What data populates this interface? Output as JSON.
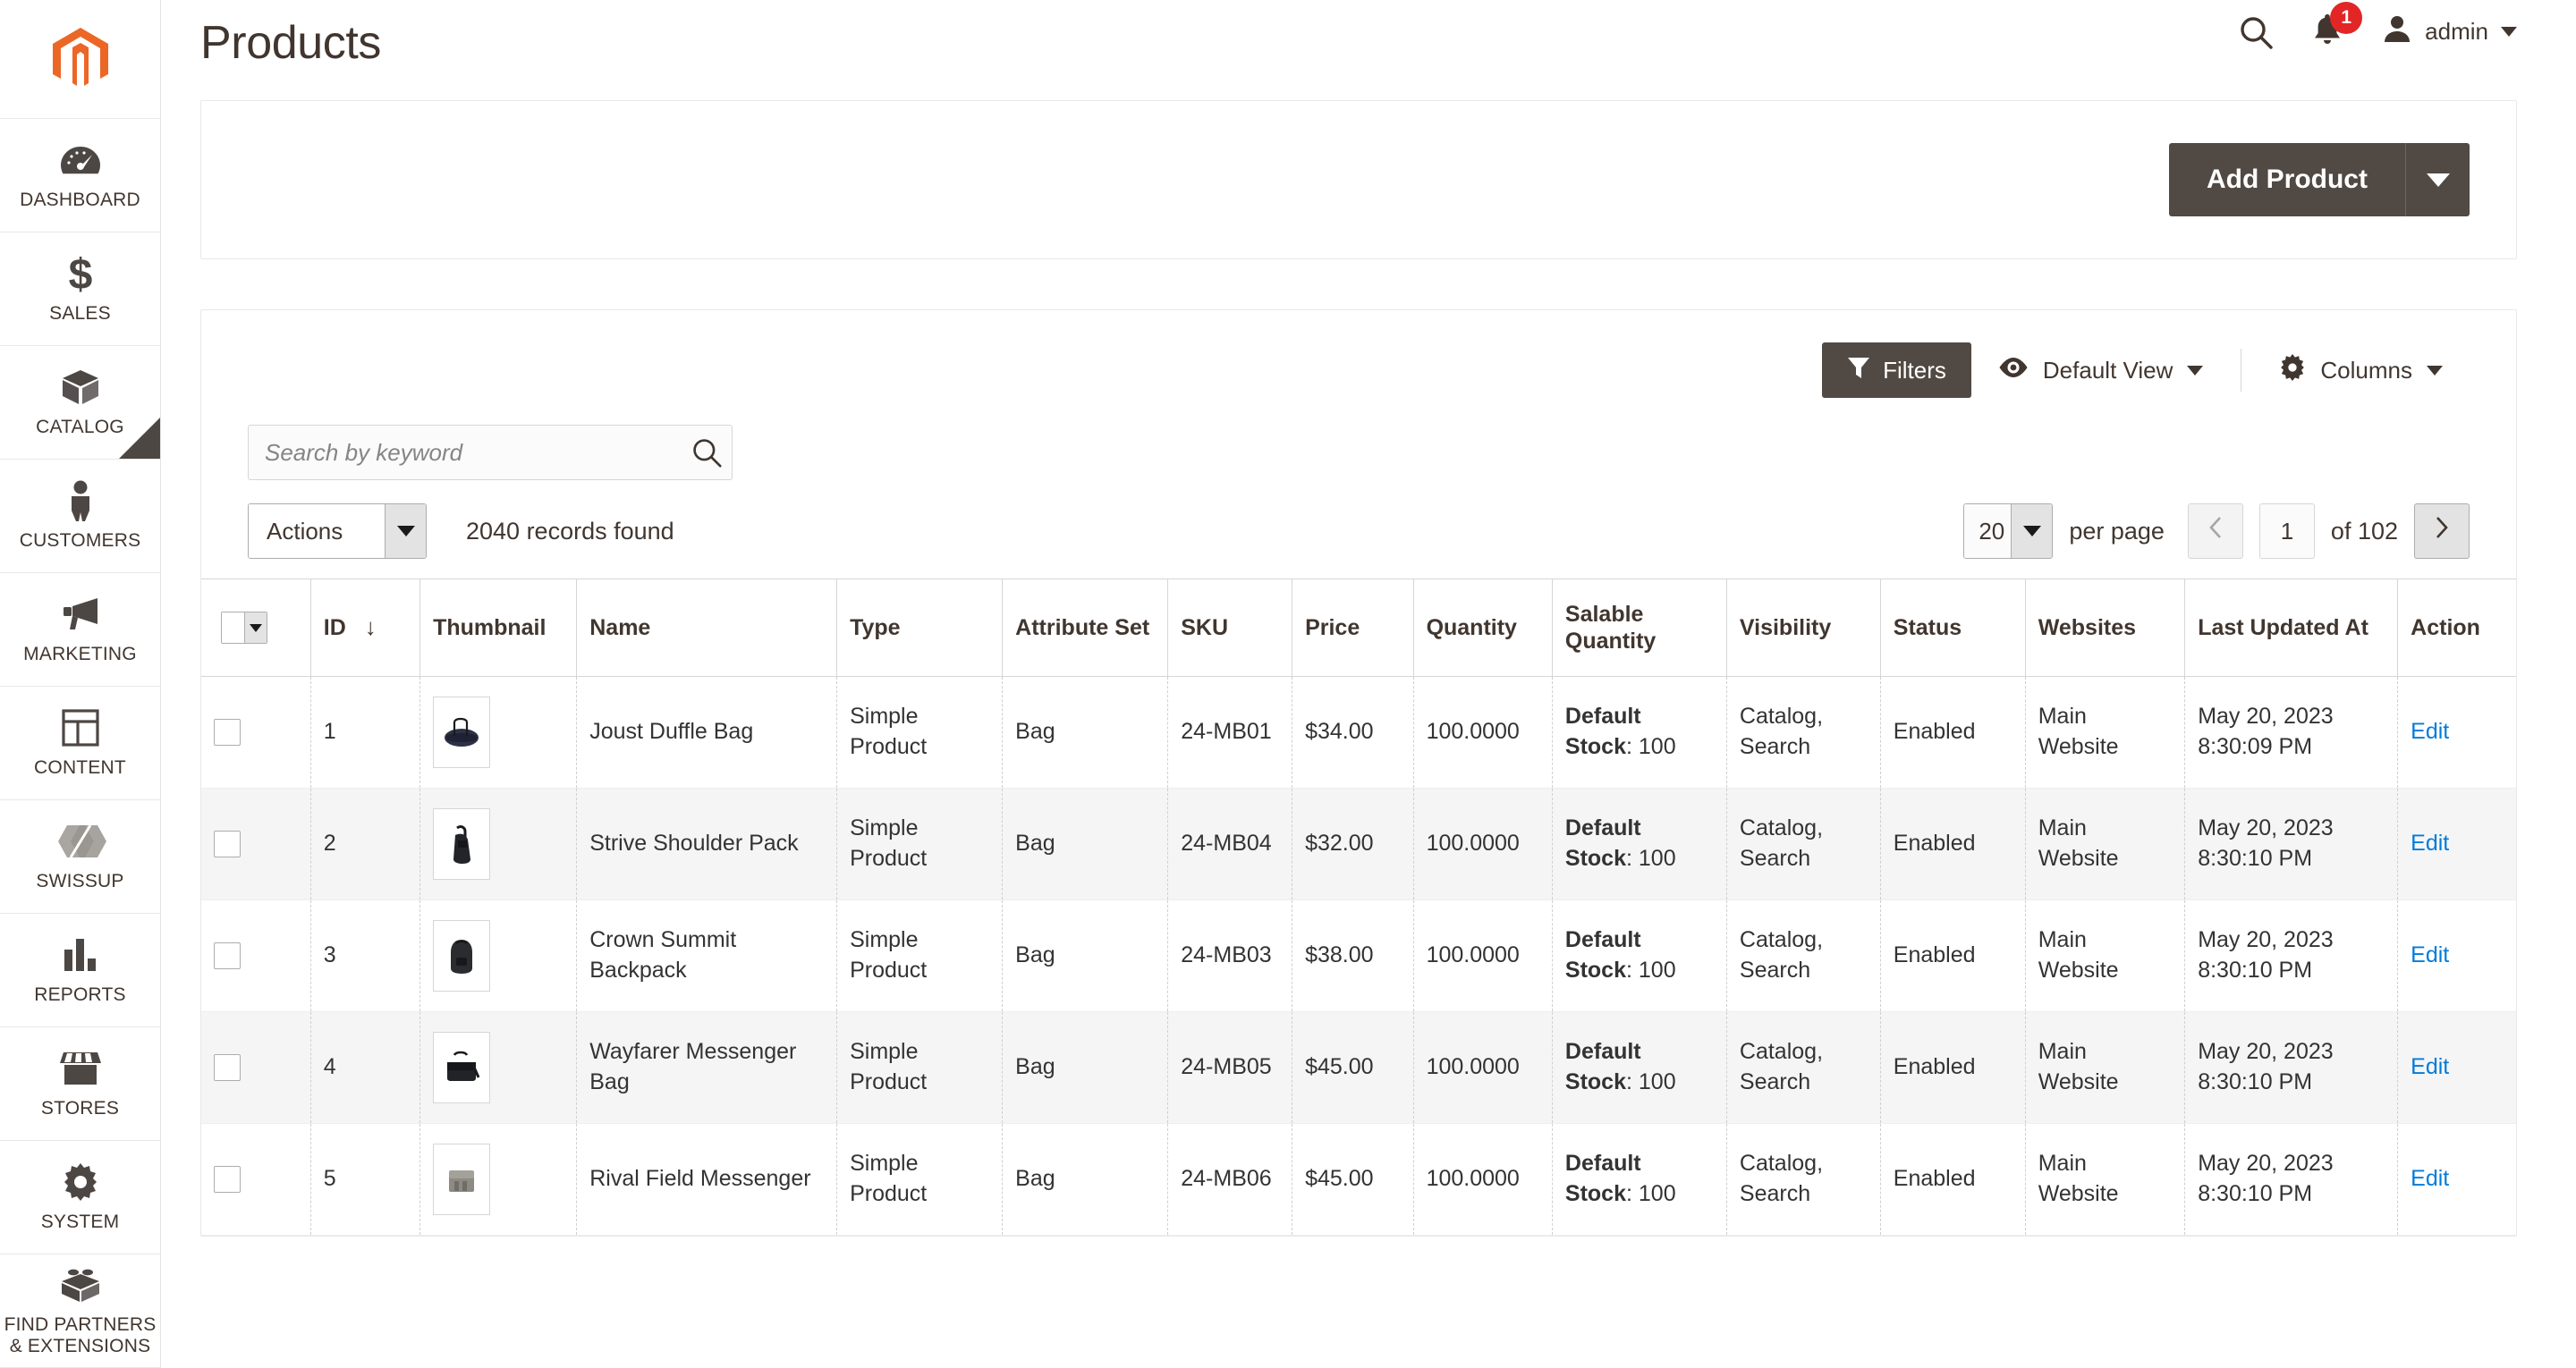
{
  "sidebar": {
    "logo_name": "magento-logo",
    "items": [
      {
        "label": "DASHBOARD",
        "icon": "dashboard-icon",
        "active": false
      },
      {
        "label": "SALES",
        "icon": "dollar-icon",
        "active": false
      },
      {
        "label": "CATALOG",
        "icon": "box-icon",
        "active": true
      },
      {
        "label": "CUSTOMERS",
        "icon": "person-icon",
        "active": false
      },
      {
        "label": "MARKETING",
        "icon": "megaphone-icon",
        "active": false
      },
      {
        "label": "CONTENT",
        "icon": "layout-icon",
        "active": false
      },
      {
        "label": "SWISSUP",
        "icon": "swissup-icon",
        "active": false
      },
      {
        "label": "REPORTS",
        "icon": "bar-chart-icon",
        "active": false
      },
      {
        "label": "STORES",
        "icon": "storefront-icon",
        "active": false
      },
      {
        "label": "SYSTEM",
        "icon": "gear-icon",
        "active": false
      },
      {
        "label": "FIND PARTNERS & EXTENSIONS",
        "icon": "brick-icon",
        "active": false
      }
    ]
  },
  "header": {
    "title": "Products",
    "search_icon": "search-icon",
    "notifications_icon": "bell-icon",
    "notifications_count": "1",
    "user_icon": "user-avatar-icon",
    "user_name": "admin"
  },
  "page_actions": {
    "add_product_label": "Add Product",
    "add_product_toggle_icon": "chevron-down-icon"
  },
  "grid_toolbar": {
    "filters_label": "Filters",
    "filters_icon": "funnel-icon",
    "view_icon": "eye-icon",
    "view_label": "Default View",
    "columns_icon": "gear-icon",
    "columns_label": "Columns"
  },
  "search": {
    "placeholder": "Search by keyword",
    "value": "",
    "button_icon": "search-icon"
  },
  "controls": {
    "actions_label": "Actions",
    "records_found": "2040 records found",
    "per_page_value": "20",
    "per_page_label": "per page",
    "prev_icon": "chevron-left-icon",
    "next_icon": "chevron-right-icon",
    "page_value": "1",
    "of_label": "of 102"
  },
  "table": {
    "columns": [
      "ID",
      "Thumbnail",
      "Name",
      "Type",
      "Attribute Set",
      "SKU",
      "Price",
      "Quantity",
      "Salable Quantity",
      "Visibility",
      "Status",
      "Websites",
      "Last Updated At",
      "Action"
    ],
    "sort_column": "ID",
    "sort_direction": "↓",
    "rows": [
      {
        "id": "1",
        "thumb": "duffle-bag-thumbnail",
        "name": "Joust Duffle Bag",
        "type": "Simple Product",
        "attribute_set": "Bag",
        "sku": "24-MB01",
        "price": "$34.00",
        "quantity": "100.0000",
        "salable_label": "Default Stock",
        "salable_value": ": 100",
        "visibility": "Catalog, Search",
        "status": "Enabled",
        "websites": "Main Website",
        "updated_at": "May 20, 2023 8:30:09 PM",
        "action": "Edit"
      },
      {
        "id": "2",
        "thumb": "shoulder-pack-thumbnail",
        "name": "Strive Shoulder Pack",
        "type": "Simple Product",
        "attribute_set": "Bag",
        "sku": "24-MB04",
        "price": "$32.00",
        "quantity": "100.0000",
        "salable_label": "Default Stock",
        "salable_value": ": 100",
        "visibility": "Catalog, Search",
        "status": "Enabled",
        "websites": "Main Website",
        "updated_at": "May 20, 2023 8:30:10 PM",
        "action": "Edit"
      },
      {
        "id": "3",
        "thumb": "backpack-thumbnail",
        "name": "Crown Summit Backpack",
        "type": "Simple Product",
        "attribute_set": "Bag",
        "sku": "24-MB03",
        "price": "$38.00",
        "quantity": "100.0000",
        "salable_label": "Default Stock",
        "salable_value": ": 100",
        "visibility": "Catalog, Search",
        "status": "Enabled",
        "websites": "Main Website",
        "updated_at": "May 20, 2023 8:30:10 PM",
        "action": "Edit"
      },
      {
        "id": "4",
        "thumb": "messenger-bag-thumbnail",
        "name": "Wayfarer Messenger Bag",
        "type": "Simple Product",
        "attribute_set": "Bag",
        "sku": "24-MB05",
        "price": "$45.00",
        "quantity": "100.0000",
        "salable_label": "Default Stock",
        "salable_value": ": 100",
        "visibility": "Catalog, Search",
        "status": "Enabled",
        "websites": "Main Website",
        "updated_at": "May 20, 2023 8:30:10 PM",
        "action": "Edit"
      },
      {
        "id": "5",
        "thumb": "field-messenger-thumbnail",
        "name": "Rival Field Messenger",
        "type": "Simple Product",
        "attribute_set": "Bag",
        "sku": "24-MB06",
        "price": "$45.00",
        "quantity": "100.0000",
        "salable_label": "Default Stock",
        "salable_value": ": 100",
        "visibility": "Catalog, Search",
        "status": "Enabled",
        "websites": "Main Website",
        "updated_at": "May 20, 2023 8:30:10 PM",
        "action": "Edit"
      }
    ]
  },
  "colors": {
    "brand_orange": "#ec6726",
    "dark_button": "#514943",
    "link_blue": "#007bdb",
    "badge_red": "#e22626",
    "text_dark": "#41362f"
  }
}
